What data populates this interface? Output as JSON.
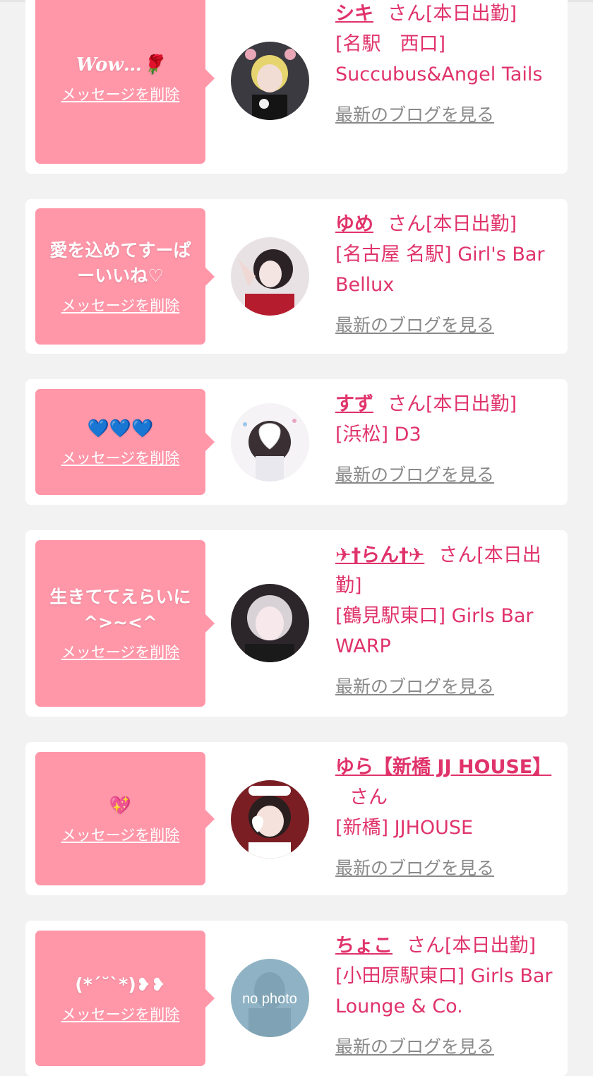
{
  "delete_label": "メッセージを削除",
  "blog_label": "最新のブログを見る",
  "colors": {
    "bubble": "#ff97a9",
    "accent": "#e0336b",
    "muted": "#8a8a8a",
    "background": "#f2f2f2"
  },
  "items": [
    {
      "message": "Wow…🌹",
      "name": "シキ",
      "honorific": "さん",
      "status": "[本日出勤]",
      "location": "[名駅　西口]",
      "store": "Succubus&Angel Tails"
    },
    {
      "message": "愛を込めてすーぱーいいね♡",
      "name": "ゆめ",
      "honorific": "さん",
      "status": "[本日出勤]",
      "location": "[名古屋 名駅]",
      "store": "Girl's Bar Bellux"
    },
    {
      "message": "💙💙💙",
      "name": "すず",
      "honorific": "さん",
      "status": "[本日出勤]",
      "location": "[浜松]",
      "store": "D3"
    },
    {
      "message": "生きててえらいに^>~<^",
      "name": "✈†らん†✈",
      "honorific": "さん",
      "status": "[本日出勤]",
      "location": "[鶴見駅東口]",
      "store": "Girls Bar WARP"
    },
    {
      "message": "💖",
      "name": "ゆら【新橋 JJ HOUSE】",
      "honorific": "さん",
      "status": "",
      "location": "[新橋]",
      "store": "JJHOUSE"
    },
    {
      "message": "(*´˘`*)❥❥",
      "name": "ちょこ",
      "honorific": "さん",
      "status": "[本日出勤]",
      "location": "[小田原駅東口]",
      "store": "Girls Bar Lounge & Co.",
      "avatar_text": "no photo"
    }
  ]
}
